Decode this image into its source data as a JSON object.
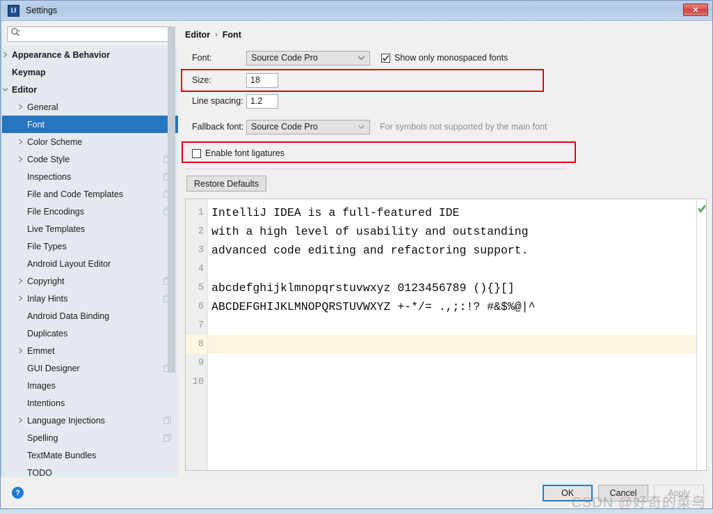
{
  "window": {
    "title": "Settings",
    "app_icon": "intellij-idea-icon",
    "close_label": "✕"
  },
  "search": {
    "value": "",
    "placeholder": "",
    "icon": "search-icon"
  },
  "sidebar": {
    "items": [
      {
        "label": "Appearance & Behavior",
        "level": 1,
        "arrow": "collapsed",
        "badge": false,
        "selected": false
      },
      {
        "label": "Keymap",
        "level": 1,
        "arrow": "none",
        "badge": false,
        "selected": false
      },
      {
        "label": "Editor",
        "level": 1,
        "arrow": "expanded",
        "badge": false,
        "selected": false
      },
      {
        "label": "General",
        "level": 2,
        "arrow": "collapsed",
        "badge": false,
        "selected": false
      },
      {
        "label": "Font",
        "level": 2,
        "arrow": "none",
        "badge": false,
        "selected": true
      },
      {
        "label": "Color Scheme",
        "level": 2,
        "arrow": "collapsed",
        "badge": false,
        "selected": false
      },
      {
        "label": "Code Style",
        "level": 2,
        "arrow": "collapsed",
        "badge": true,
        "selected": false
      },
      {
        "label": "Inspections",
        "level": 2,
        "arrow": "none",
        "badge": true,
        "selected": false
      },
      {
        "label": "File and Code Templates",
        "level": 2,
        "arrow": "none",
        "badge": true,
        "selected": false
      },
      {
        "label": "File Encodings",
        "level": 2,
        "arrow": "none",
        "badge": true,
        "selected": false
      },
      {
        "label": "Live Templates",
        "level": 2,
        "arrow": "none",
        "badge": false,
        "selected": false
      },
      {
        "label": "File Types",
        "level": 2,
        "arrow": "none",
        "badge": false,
        "selected": false
      },
      {
        "label": "Android Layout Editor",
        "level": 2,
        "arrow": "none",
        "badge": false,
        "selected": false
      },
      {
        "label": "Copyright",
        "level": 2,
        "arrow": "collapsed",
        "badge": true,
        "selected": false
      },
      {
        "label": "Inlay Hints",
        "level": 2,
        "arrow": "collapsed",
        "badge": true,
        "selected": false
      },
      {
        "label": "Android Data Binding",
        "level": 2,
        "arrow": "none",
        "badge": false,
        "selected": false
      },
      {
        "label": "Duplicates",
        "level": 2,
        "arrow": "none",
        "badge": false,
        "selected": false
      },
      {
        "label": "Emmet",
        "level": 2,
        "arrow": "collapsed",
        "badge": false,
        "selected": false
      },
      {
        "label": "GUI Designer",
        "level": 2,
        "arrow": "none",
        "badge": true,
        "selected": false
      },
      {
        "label": "Images",
        "level": 2,
        "arrow": "none",
        "badge": false,
        "selected": false
      },
      {
        "label": "Intentions",
        "level": 2,
        "arrow": "none",
        "badge": false,
        "selected": false
      },
      {
        "label": "Language Injections",
        "level": 2,
        "arrow": "collapsed",
        "badge": true,
        "selected": false
      },
      {
        "label": "Spelling",
        "level": 2,
        "arrow": "none",
        "badge": true,
        "selected": false
      },
      {
        "label": "TextMate Bundles",
        "level": 2,
        "arrow": "none",
        "badge": false,
        "selected": false
      },
      {
        "label": "TODO",
        "level": 2,
        "arrow": "none",
        "badge": false,
        "selected": false
      }
    ]
  },
  "breadcrumb": {
    "root": "Editor",
    "separator": "›",
    "leaf": "Font"
  },
  "form": {
    "font_label": "Font:",
    "font_value": "Source Code Pro",
    "monospaced_label": "Show only monospaced fonts",
    "monospaced_checked": true,
    "size_label": "Size:",
    "size_value": "18",
    "line_spacing_label": "Line spacing:",
    "line_spacing_value": "1.2",
    "fallback_label": "Fallback font:",
    "fallback_value": "Source Code Pro",
    "fallback_hint": "For symbols not supported by the main font",
    "ligatures_label": "Enable font ligatures",
    "ligatures_checked": false,
    "restore_defaults_label": "Restore Defaults"
  },
  "preview": {
    "line_numbers": [
      "1",
      "2",
      "3",
      "4",
      "5",
      "6",
      "7",
      "8",
      "9",
      "10"
    ],
    "lines": [
      "IntelliJ IDEA is a full-featured IDE",
      "with a high level of usability and outstanding",
      "advanced code editing and refactoring support.",
      "",
      "abcdefghijklmnopqrstuvwxyz 0123456789 (){}[]",
      "ABCDEFGHIJKLMNOPQRSTUVWXYZ +-*/= .,;:!? #&$%@|^",
      "",
      "",
      "",
      ""
    ],
    "highlighted_line": 8,
    "status_icon": "green-checkmark-icon"
  },
  "footer": {
    "help_label": "?",
    "ok_label": "OK",
    "cancel_label": "Cancel",
    "apply_label": "Apply"
  },
  "watermark": {
    "text": "CSDN @好奇的菜鸟"
  },
  "colors": {
    "accent": "#2675bf",
    "highlight_box": "#e60012",
    "titlebar": "#bcd2ea",
    "sidebar_bg": "#e4eaf0",
    "current_line": "#fdf7e2"
  }
}
